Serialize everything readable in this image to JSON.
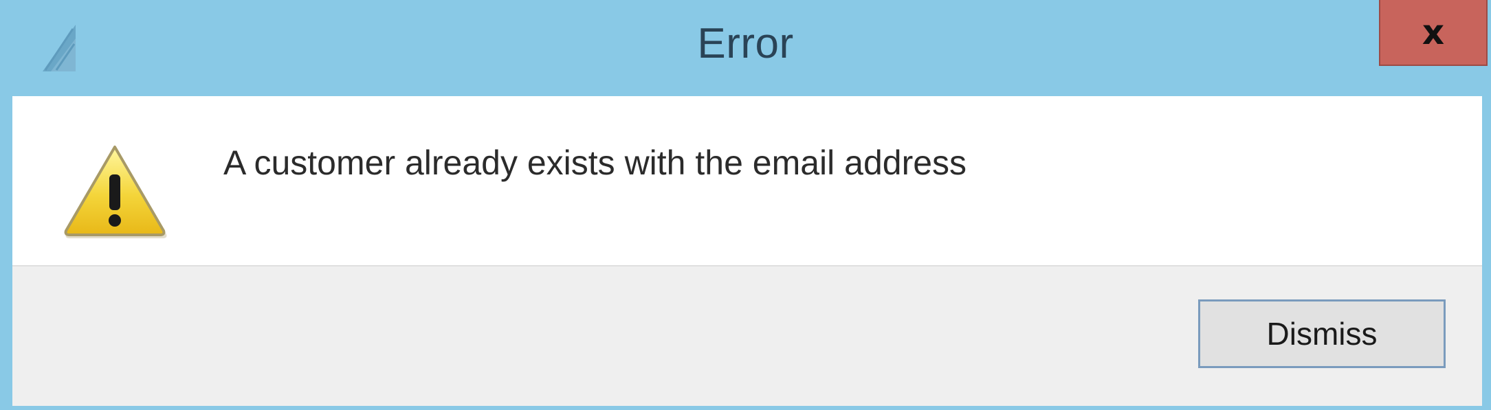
{
  "window": {
    "title": "Error",
    "close_label": "x",
    "accent_color": "#89c9e6",
    "close_color": "#c8645c"
  },
  "dialog": {
    "message": "A customer already exists with the email address",
    "icon": "warning-icon"
  },
  "footer": {
    "dismiss_label": "Dismiss"
  }
}
